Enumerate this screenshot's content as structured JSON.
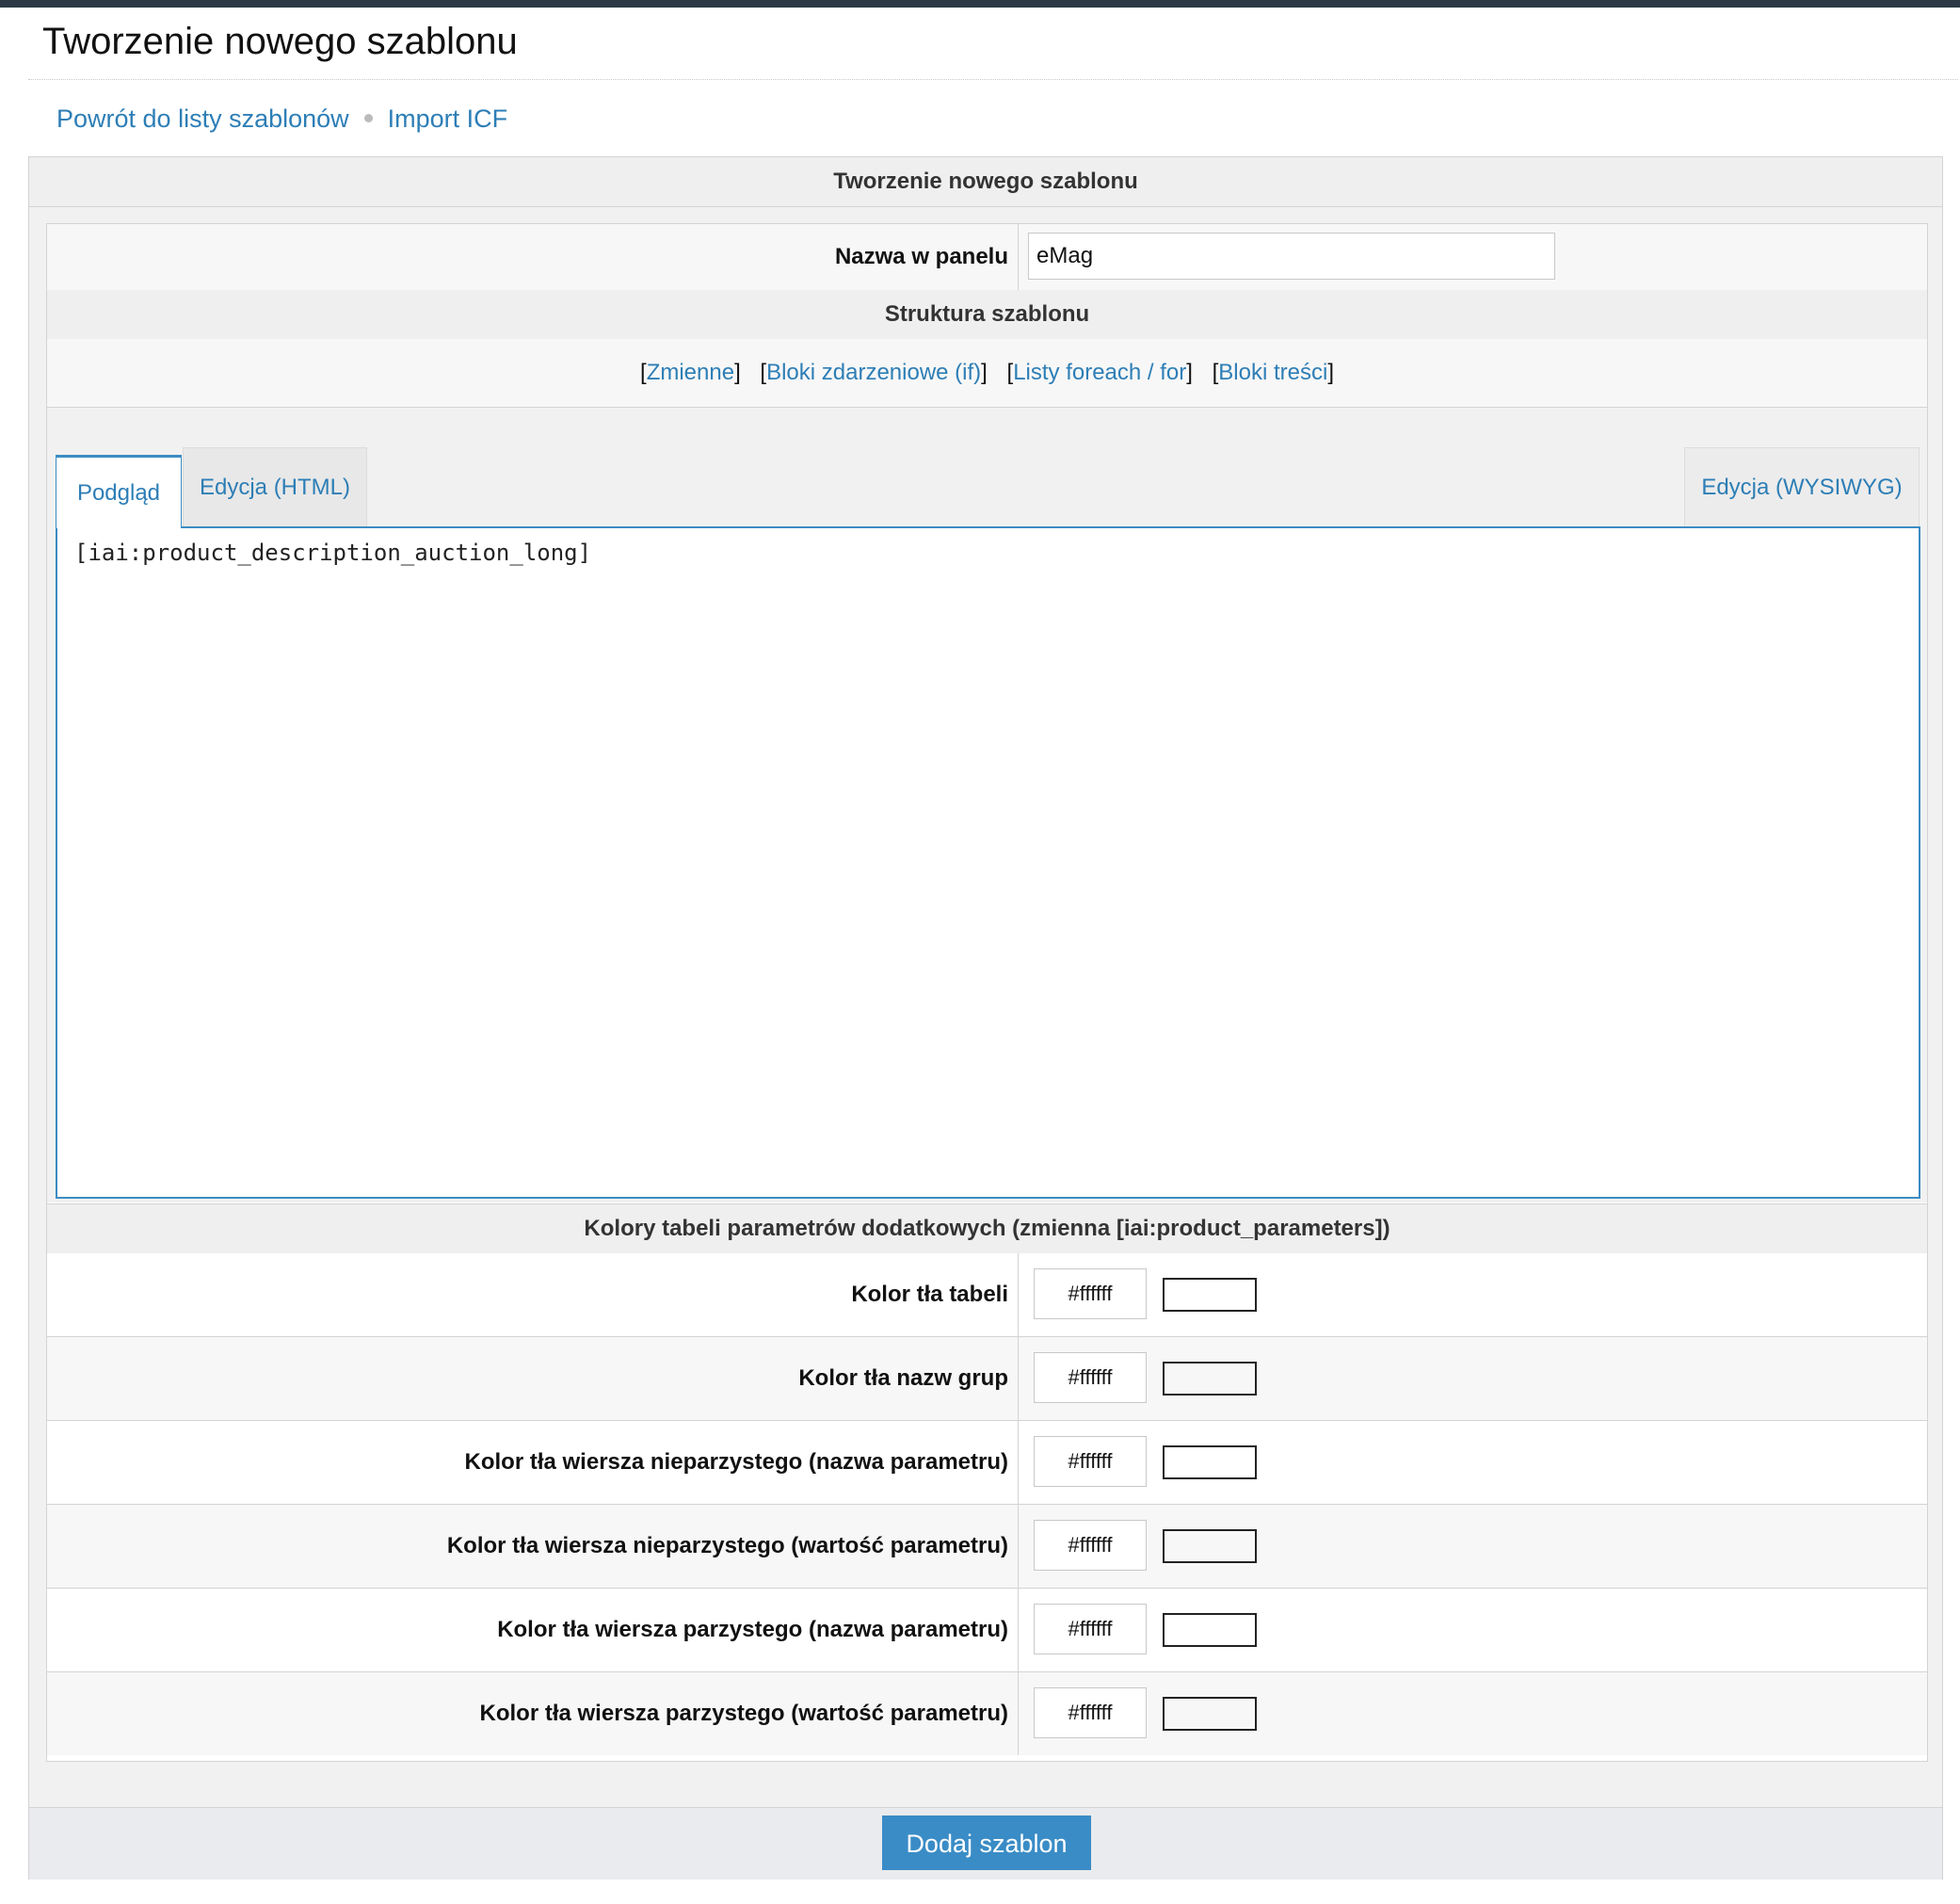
{
  "page": {
    "title": "Tworzenie nowego szablonu",
    "links": [
      "Powrót do listy szablonów",
      "Import ICF"
    ]
  },
  "panel": {
    "heading": "Tworzenie nowego szablonu",
    "name_label": "Nazwa w panelu",
    "name_value": "eMag",
    "structure_heading": "Struktura szablonu",
    "structure_links": [
      "Zmienne",
      "Bloki zdarzeniowe (if)",
      "Listy foreach / for",
      "Bloki treści"
    ]
  },
  "editor": {
    "tabs": {
      "preview": "Podgląd",
      "html": "Edycja (HTML)",
      "wysiwyg": "Edycja (WYSIWYG)"
    },
    "content": "[iai:product_description_auction_long]"
  },
  "colors": {
    "heading": "Kolory tabeli parametrów dodatkowych (zmienna [iai:product_parameters])",
    "rows": [
      {
        "label": "Kolor tła tabeli",
        "value": "#ffffff"
      },
      {
        "label": "Kolor tła nazw grup",
        "value": "#ffffff"
      },
      {
        "label": "Kolor tła wiersza nieparzystego (nazwa parametru)",
        "value": "#ffffff"
      },
      {
        "label": "Kolor tła wiersza nieparzystego (wartość parametru)",
        "value": "#ffffff"
      },
      {
        "label": "Kolor tła wiersza parzystego (nazwa parametru)",
        "value": "#ffffff"
      },
      {
        "label": "Kolor tła wiersza parzystego (wartość parametru)",
        "value": "#ffffff"
      }
    ]
  },
  "footer": {
    "submit_label": "Dodaj szablon"
  },
  "theme": {
    "link_color": "#2d7eb6",
    "button_color": "#3a8cc6",
    "topbar_color": "#2c3944"
  }
}
